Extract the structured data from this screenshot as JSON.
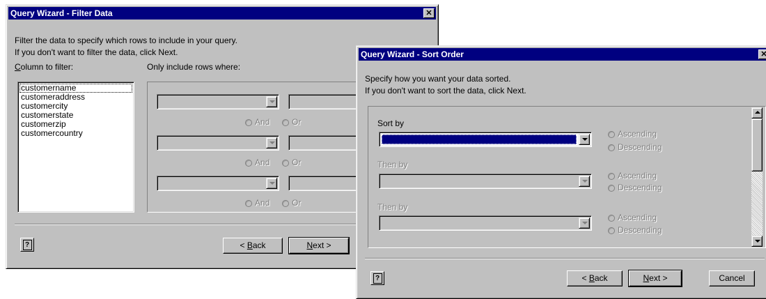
{
  "filter_dialog": {
    "title": "Query Wizard - Filter Data",
    "close_glyph": "✕",
    "instruction_line1": "Filter the data to specify which rows to include in your query.",
    "instruction_line2": "If you don't want to filter the data, click Next.",
    "column_label": "Column to filter:",
    "column_label_mnemonic": "C",
    "column_label_rest": "olumn to filter:",
    "rows_label": "Only include rows where:",
    "columns": [
      "customername",
      "customeraddress",
      "customercity",
      "customerstate",
      "customerzip",
      "customercountry"
    ],
    "selected_column": "customername",
    "and_label": "And",
    "or_label": "Or",
    "back_label_pre": "< ",
    "back_mnemonic": "B",
    "back_rest": "ack",
    "next_mnemonic": "N",
    "next_rest": "ext >",
    "help_glyph": "?"
  },
  "sort_dialog": {
    "title": "Query Wizard - Sort Order",
    "close_glyph": "✕",
    "instruction_line1": "Specify how you want your data sorted.",
    "instruction_line2": "If you don't want to sort the data, click Next.",
    "sort_by_label": "Sort by",
    "then_by_label": "Then by",
    "ascending_label": "Ascending",
    "descending_label": "Descending",
    "back_label_pre": "< ",
    "back_mnemonic": "B",
    "back_rest": "ack",
    "next_mnemonic": "N",
    "next_rest": "ext >",
    "cancel_label": "Cancel",
    "help_glyph": "?"
  },
  "colors": {
    "title_bar": "#000080",
    "window_face": "#c0c0c0",
    "selection": "#000080"
  }
}
